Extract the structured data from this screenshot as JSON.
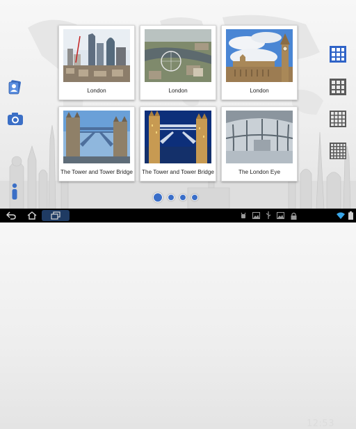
{
  "cards": [
    {
      "caption": "London",
      "photo": "city-skyline"
    },
    {
      "caption": "London",
      "photo": "london-eye-aerial"
    },
    {
      "caption": "London",
      "photo": "parliament-big-ben"
    },
    {
      "caption": "The Tower and Tower Bridge",
      "photo": "tower-bridge-day"
    },
    {
      "caption": "The Tower and Tower Bridge",
      "photo": "tower-bridge-night"
    },
    {
      "caption": "The London Eye",
      "photo": "london-eye-capsule"
    }
  ],
  "left_toolbar": [
    "contacts-icon",
    "camera-icon",
    "info-icon"
  ],
  "right_toolbar": [
    "grid-3x3-selected-icon",
    "grid-3x3-icon",
    "grid-4x4-icon",
    "grid-5x5-icon"
  ],
  "pager": {
    "pages": 4,
    "current": 1
  },
  "status_bar": {
    "time": "12:53"
  },
  "colors": {
    "accent": "#3a6ec8",
    "nav_bar": "#000000"
  }
}
